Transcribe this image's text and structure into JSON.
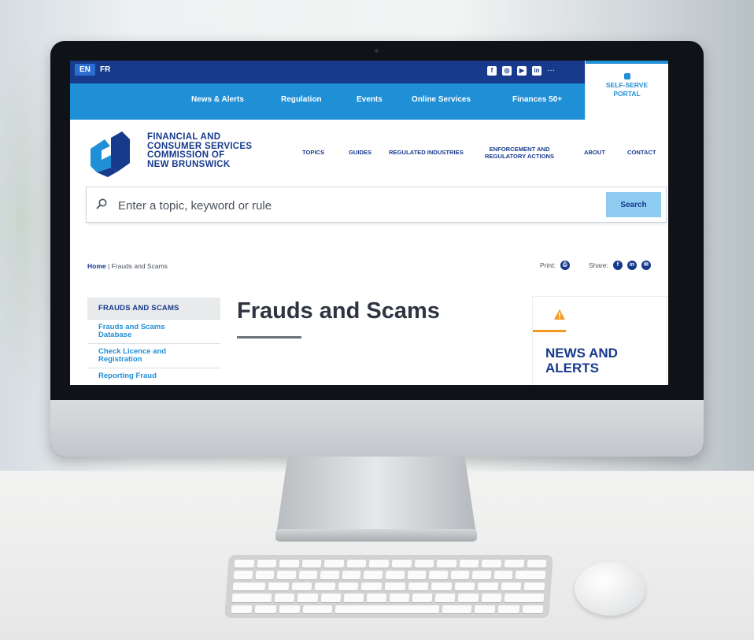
{
  "site": {
    "languages": [
      "EN",
      "FR"
    ],
    "social_icons": [
      "facebook-icon",
      "instagram-icon",
      "youtube-icon",
      "linkedin-icon"
    ],
    "more_label": "···",
    "top_nav": [
      "News & Alerts",
      "Regulation",
      "Events",
      "Online Services",
      "Finances 50+"
    ],
    "portal_label": "SELF-SERVE\nPORTAL",
    "logo_text": "FINANCIAL AND\nCONSUMER SERVICES\nCOMMISSION OF\nNEW BRUNSWICK",
    "main_nav": [
      "TOPICS",
      "GUIDES",
      "REGULATED INDUSTRIES",
      "ENFORCEMENT AND\nREGULATORY ACTIONS",
      "ABOUT",
      "CONTACT"
    ],
    "search": {
      "placeholder": "Enter a topic, keyword or rule",
      "button": "Search"
    },
    "breadcrumb": {
      "home": "Home",
      "current": "Frauds and Scams"
    },
    "print_label": "Print:",
    "share_label": "Share:",
    "sidebar": {
      "heading": "FRAUDS AND SCAMS",
      "items": [
        "Frauds and Scams\nDatabase",
        "Check Licence and\nRegistration",
        "Reporting Fraud"
      ]
    },
    "page_title": "Frauds and Scams",
    "news_title": "NEWS AND\nALERTS",
    "colors": {
      "navy": "#173a8d",
      "blue": "#1f8fd6",
      "light_blue": "#8ecbf1",
      "orange": "#f29a22"
    }
  }
}
